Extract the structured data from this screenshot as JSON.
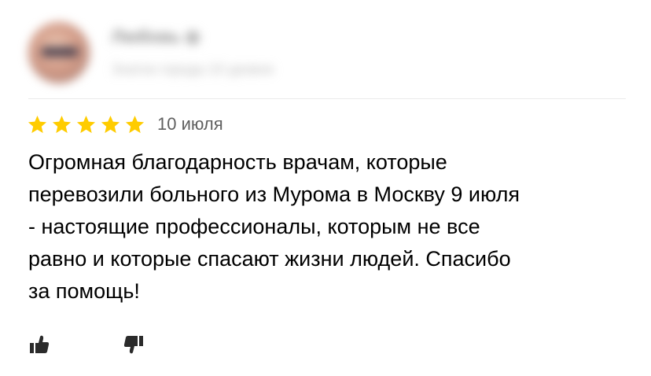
{
  "review": {
    "author": {
      "name": "Любовь",
      "level": "Знаток города 10 уровня",
      "icon": "avatar"
    },
    "rating": {
      "stars": 5,
      "max": 5,
      "star_color": "#ffcc00"
    },
    "date": "10 июля",
    "text": "Огромная благодарность врачам, которые\nперевозили больного из Мурома в Москву 9 июля\n- настоящие профессионалы, которым не все\nравно и которые спасают жизни людей. Спасибо\nза помощь!",
    "reactions": {
      "like_icon": "thumbs-up-icon",
      "dislike_icon": "thumbs-down-icon"
    }
  }
}
